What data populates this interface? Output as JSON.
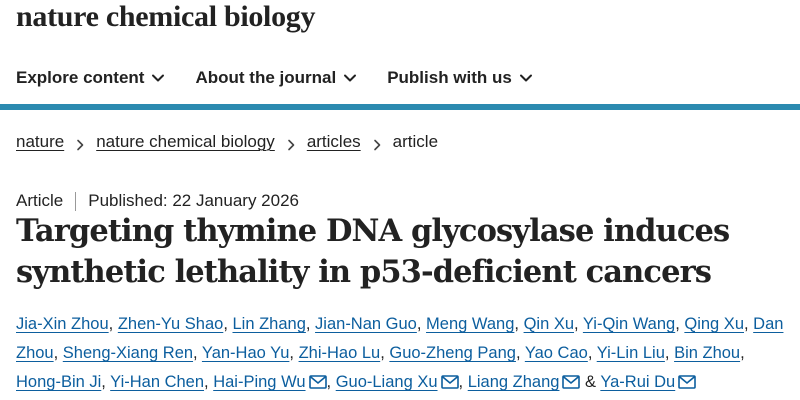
{
  "brand": {
    "name": "nature chemical biology"
  },
  "nav": {
    "items": [
      {
        "label": "Explore content",
        "icon": "chevron-down-icon"
      },
      {
        "label": "About the journal",
        "icon": "chevron-down-icon"
      },
      {
        "label": "Publish with us",
        "icon": "chevron-down-icon"
      }
    ]
  },
  "colors": {
    "accent": "#2b8ab0",
    "author_link": "#0c5e9e",
    "text": "#222222"
  },
  "breadcrumb": {
    "items": [
      "nature",
      "nature chemical biology",
      "articles"
    ],
    "current": "article",
    "separator_icon": "chevron-right-icon"
  },
  "article": {
    "type": "Article",
    "published": "Published: 22 January 2026",
    "title": "Targeting thymine DNA glycosylase induces synthetic lethality in p53-deficient cancers",
    "authors": [
      {
        "name": "Jia-Xin Zhou"
      },
      {
        "name": "Zhen-Yu Shao"
      },
      {
        "name": "Lin Zhang"
      },
      {
        "name": "Jian-Nan Guo"
      },
      {
        "name": "Meng Wang"
      },
      {
        "name": "Qin Xu"
      },
      {
        "name": "Yi-Qin Wang"
      },
      {
        "name": "Qing Xu"
      },
      {
        "name": "Dan Zhou"
      },
      {
        "name": "Sheng-Xiang Ren"
      },
      {
        "name": "Yan-Hao Yu"
      },
      {
        "name": "Zhi-Hao Lu"
      },
      {
        "name": "Guo-Zheng Pang"
      },
      {
        "name": "Yao Cao"
      },
      {
        "name": "Yi-Lin Liu"
      },
      {
        "name": "Bin Zhou"
      },
      {
        "name": "Hong-Bin Ji"
      },
      {
        "name": "Yi-Han Chen"
      },
      {
        "name": "Hai-Ping Wu",
        "email_icon": "mail-icon"
      },
      {
        "name": "Guo-Liang Xu",
        "email_icon": "mail-icon"
      },
      {
        "name": "Liang Zhang",
        "email_icon": "mail-icon"
      },
      {
        "name": "Ya-Rui Du",
        "email_icon": "mail-icon"
      }
    ],
    "last_author_joiner": "&"
  }
}
